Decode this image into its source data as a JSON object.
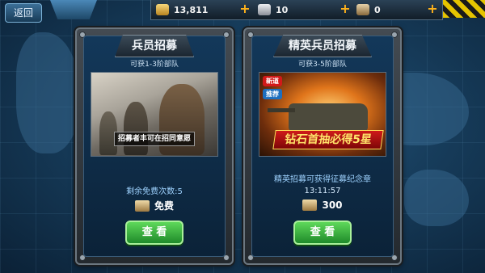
{
  "top_bar": {
    "back_label": "返回",
    "resources": [
      {
        "name": "gold",
        "icon": "gold-bars-icon",
        "value": "13,811",
        "color": "#e7b642"
      },
      {
        "name": "silver",
        "icon": "silver-icon",
        "value": "10",
        "color": "#c9ccd2"
      },
      {
        "name": "scroll",
        "icon": "scroll-icon",
        "value": "0",
        "color": "#c7a97a"
      }
    ],
    "plus_label": "+"
  },
  "cards": [
    {
      "title": "兵员招募",
      "subtitle": "可获1-3阶部队",
      "image_caption": "招募者丰可在招同意愿",
      "info": "剩余免费次数:5",
      "cost_icon": "scroll-icon",
      "cost": "免费",
      "button": "查 看"
    },
    {
      "title": "精英兵员招募",
      "subtitle": "可获3-5阶部队",
      "badge_hot": "新道",
      "badge_elite": "推荐",
      "image_caption": "钻石首抽必得5星",
      "info": "精英招募可获得征募纪念章",
      "timer": "13:11:57",
      "cost_icon": "scroll-icon",
      "cost": "300",
      "button": "查 看"
    }
  ],
  "colors": {
    "accent_gold": "#ffb21b",
    "button_green": "#2da83a",
    "banner_red": "#b31010"
  }
}
